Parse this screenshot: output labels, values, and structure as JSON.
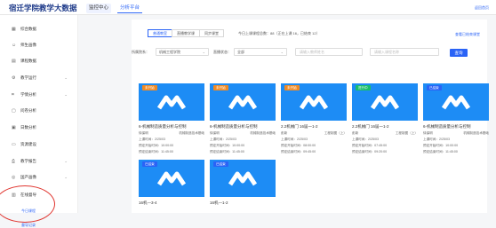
{
  "header": {
    "title": "宿迁学院教学大数据",
    "nav": [
      "监控中心",
      "分析平台"
    ],
    "right_link": "返回首页"
  },
  "sidebar": {
    "items": [
      {
        "label": "综合数据",
        "icon": "grid-icon"
      },
      {
        "label": "师生画像",
        "icon": "user-icon"
      },
      {
        "label": "课程数据",
        "icon": "book-icon"
      },
      {
        "label": "教学运行",
        "icon": "gear-icon",
        "arrow": true
      },
      {
        "label": "学情分析",
        "icon": "chart-icon",
        "arrow": true
      },
      {
        "label": "问卷分析",
        "icon": "doc-icon"
      },
      {
        "label": "日数分析",
        "icon": "calendar-icon"
      },
      {
        "label": "资源建设",
        "icon": "folder-icon"
      },
      {
        "label": "教学报告",
        "icon": "report-icon",
        "arrow": true
      },
      {
        "label": "国产画像",
        "icon": "portrait-icon",
        "arrow": true
      },
      {
        "label": "在线督导",
        "icon": "monitor-icon"
      }
    ],
    "sub_items": [
      "今日课程",
      "督导记录"
    ]
  },
  "main": {
    "tabs": [
      "普通教室",
      "直播教学课",
      "同步课堂"
    ],
    "stats": "今日上课课程总数：88（正在上课 16，已结束 12）",
    "export_link": "查看已结束课堂",
    "filters": {
      "college_label": "所属院系：",
      "college_value": "机械工程学院",
      "status_label": "直播状态：",
      "status_value": "全部",
      "teacher_placeholder": "请输入教师姓名",
      "course_placeholder": "请输入课程名称",
      "search_btn": "查询"
    },
    "cards": [
      {
        "badge": "未开始",
        "badge_color": "#f08a24",
        "title": "6-机械制造质量分析与控制",
        "teacher": "徐保明",
        "course": "机械制造技术基础",
        "period": "上课时间：2/25/03",
        "start": "预定开始时间：10:00:00",
        "end": "预定结束时间：11:45:00"
      },
      {
        "badge": "未开始",
        "badge_color": "#f08a24",
        "title": "6-机械制造质量分析与控制",
        "teacher": "徐保明",
        "course": "机械制造技术基础",
        "period": "上课时间：2/25/03",
        "start": "预定开始时间：10:00:00",
        "end": "预定结束时间：11:45:00"
      },
      {
        "badge": "未开始",
        "badge_color": "#f08a24",
        "title": "2.2机械门 16届一1-2",
        "teacher": "彭新",
        "course": "工程制图（上）",
        "period": "上课时间：2/25/03",
        "start": "预定开始时间：08:00:00",
        "end": "预定结束时间：09:45:00"
      },
      {
        "badge": "进行中",
        "badge_color": "#19be6b",
        "title": "2.2机械门 16届一1-2",
        "teacher": "彭新",
        "course": "工程制图（上）",
        "period": "上课时间：2/25/03",
        "start": "预定开始时间：07:45:00",
        "end": "预定结束时间：09:20:00"
      },
      {
        "badge": "已结束",
        "badge_color": "#2a63f6",
        "title": "6-机械制造质量分析与控制",
        "teacher": "徐保明",
        "course": "机械制造技术基础",
        "period": "上课时间：2/25/03",
        "start": "预定开始时间：10:00:00",
        "end": "预定结束时间：11:45:00"
      },
      {
        "badge": "已结束",
        "badge_color": "#2a63f6",
        "title": "16机—3-4",
        "teacher": "",
        "course": "",
        "period": "",
        "start": "",
        "end": ""
      },
      {
        "badge": "已结束",
        "badge_color": "#2a63f6",
        "title": "16机—1-2",
        "teacher": "",
        "course": "",
        "period": "",
        "start": "",
        "end": ""
      }
    ]
  }
}
